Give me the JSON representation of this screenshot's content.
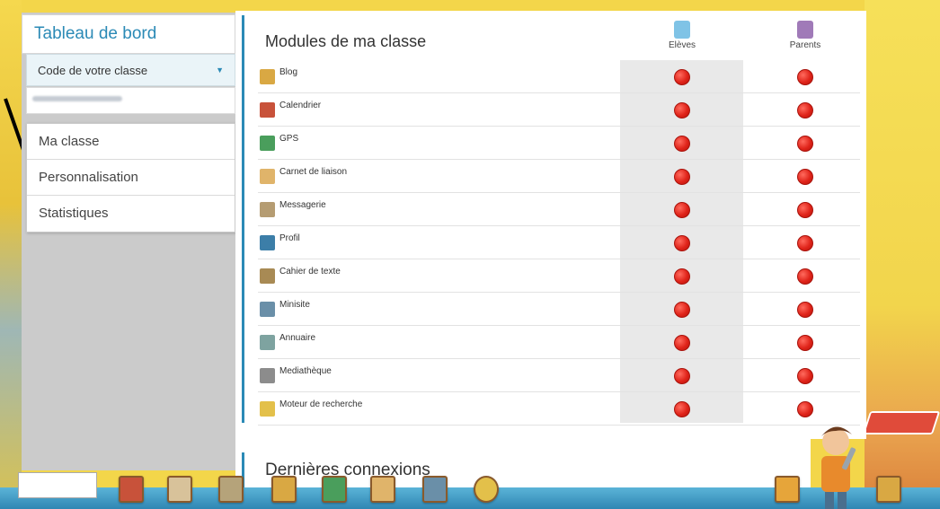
{
  "sidebar": {
    "brand": "Tableau de bord",
    "class_code_label": "Code de votre classe",
    "menu": [
      "Ma classe",
      "Personnalisation",
      "Statistiques"
    ]
  },
  "modules": {
    "title": "Modules de ma classe",
    "columns": [
      "Elèves",
      "Parents"
    ],
    "items": [
      {
        "label": "Blog",
        "icon": "blog-icon",
        "color": "#d9a843"
      },
      {
        "label": "Calendrier",
        "icon": "calendar-icon",
        "color": "#c8523a"
      },
      {
        "label": "GPS",
        "icon": "globe-icon",
        "color": "#4a9e5c"
      },
      {
        "label": "Carnet de liaison",
        "icon": "notebook-icon",
        "color": "#e0b46a"
      },
      {
        "label": "Messagerie",
        "icon": "envelope-icon",
        "color": "#b59c72"
      },
      {
        "label": "Profil",
        "icon": "profile-icon",
        "color": "#3c7ea8"
      },
      {
        "label": "Cahier de texte",
        "icon": "textbook-icon",
        "color": "#a88a54"
      },
      {
        "label": "Minisite",
        "icon": "website-icon",
        "color": "#6a8fa8"
      },
      {
        "label": "Annuaire",
        "icon": "directory-icon",
        "color": "#7ea3a0"
      },
      {
        "label": "Mediathèque",
        "icon": "media-icon",
        "color": "#8c8c8c"
      },
      {
        "label": "Moteur de recherche",
        "icon": "magnifier-icon",
        "color": "#e3c04a"
      }
    ],
    "status_color": "#e0241a"
  },
  "connections": {
    "title": "Dernières connexions"
  }
}
